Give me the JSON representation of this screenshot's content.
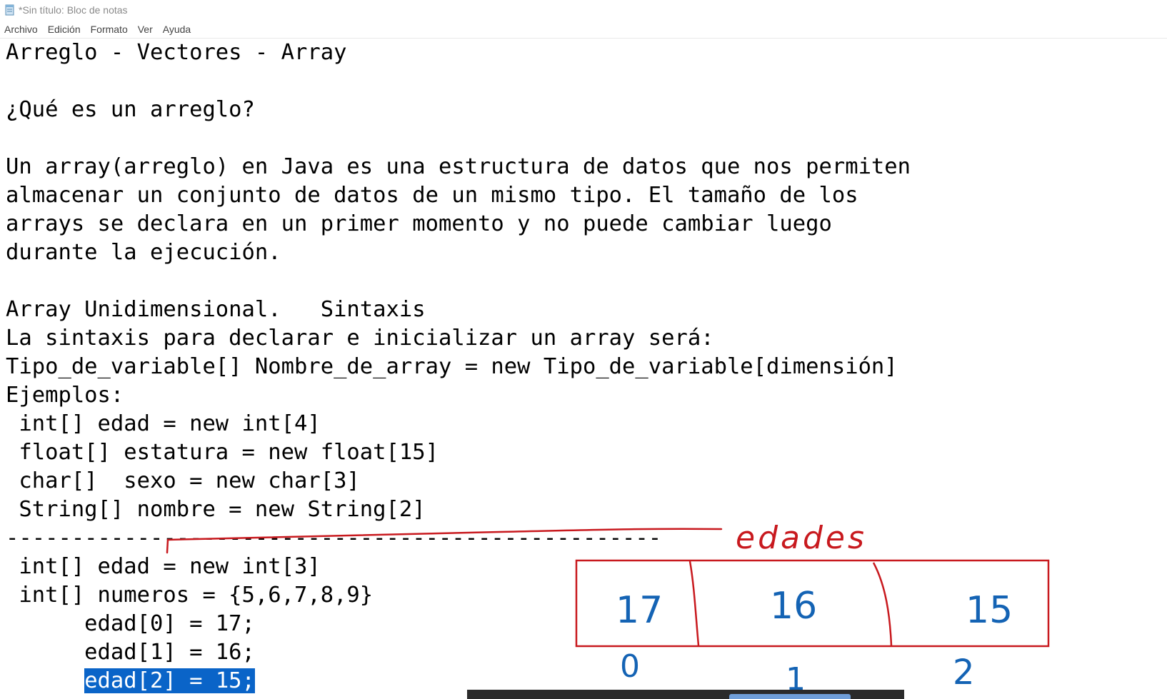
{
  "window": {
    "title": "*Sin título: Bloc de notas"
  },
  "menu": [
    "Archivo",
    "Edición",
    "Formato",
    "Ver",
    "Ayuda"
  ],
  "editor": {
    "lines": [
      "Arreglo - Vectores - Array",
      "",
      "¿Qué es un arreglo?",
      "",
      "Un array(arreglo) en Java es una estructura de datos que nos permiten",
      "almacenar un conjunto de datos de un mismo tipo. El tamaño de los",
      "arrays se declara en un primer momento y no puede cambiar luego",
      "durante la ejecución.",
      "",
      "Array Unidimensional.   Sintaxis",
      "La sintaxis para declarar e inicializar un array será:",
      "Tipo_de_variable[] Nombre_de_array = new Tipo_de_variable[dimensión]",
      "Ejemplos:",
      " int[] edad = new int[4]",
      " float[] estatura = new float[15]",
      " char[]  sexo = new char[3]",
      " String[] nombre = new String[2]",
      "--------------------------------------------------",
      " int[] edad = new int[3]",
      " int[] numeros = {5,6,7,8,9}",
      "      edad[0] = 17;",
      "      edad[1] = 16;"
    ],
    "selected_indent": "      ",
    "selected_text": "edad[2] = 15;"
  },
  "annotation": {
    "array_label": "edades",
    "cells": [
      "17",
      "16",
      "15"
    ],
    "indices": [
      "0",
      "1",
      "2"
    ],
    "colors": {
      "red": "#c8191e",
      "blue": "#1463b4",
      "selection": "#0a64c8"
    }
  }
}
